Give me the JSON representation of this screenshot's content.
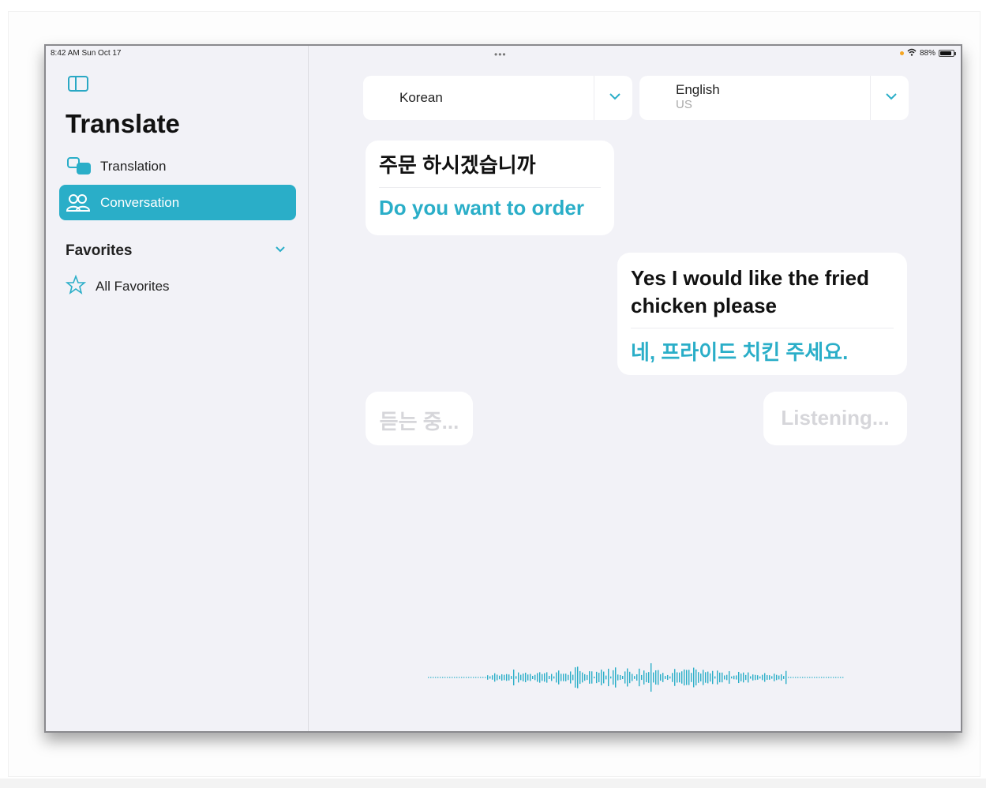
{
  "status_bar": {
    "time": "8:42 AM  Sun Oct 17",
    "dots": "•••",
    "battery_percent": "88%"
  },
  "sidebar": {
    "title": "Translate",
    "items": [
      {
        "label": "Translation",
        "icon": "translation-bubbles-icon",
        "selected": false
      },
      {
        "label": "Conversation",
        "icon": "people-icon",
        "selected": true
      }
    ],
    "favorites": {
      "label": "Favorites",
      "items": [
        {
          "label": "All Favorites",
          "icon": "star-icon"
        }
      ]
    }
  },
  "languages": {
    "left": {
      "name": "Korean",
      "region": ""
    },
    "right": {
      "name": "English",
      "region": "US"
    }
  },
  "conversation": [
    {
      "source": "주문 하시겠습니까",
      "translation": "Do you want to order"
    },
    {
      "source": "Yes I would like the fried chicken please",
      "translation": "네, 프라이드 치킨 주세요."
    }
  ],
  "listening": {
    "korean": "듣는 중...",
    "english": "Listening..."
  },
  "colors": {
    "accent": "#2aaec8",
    "background": "#f2f2f7",
    "bubble": "#ffffff"
  }
}
